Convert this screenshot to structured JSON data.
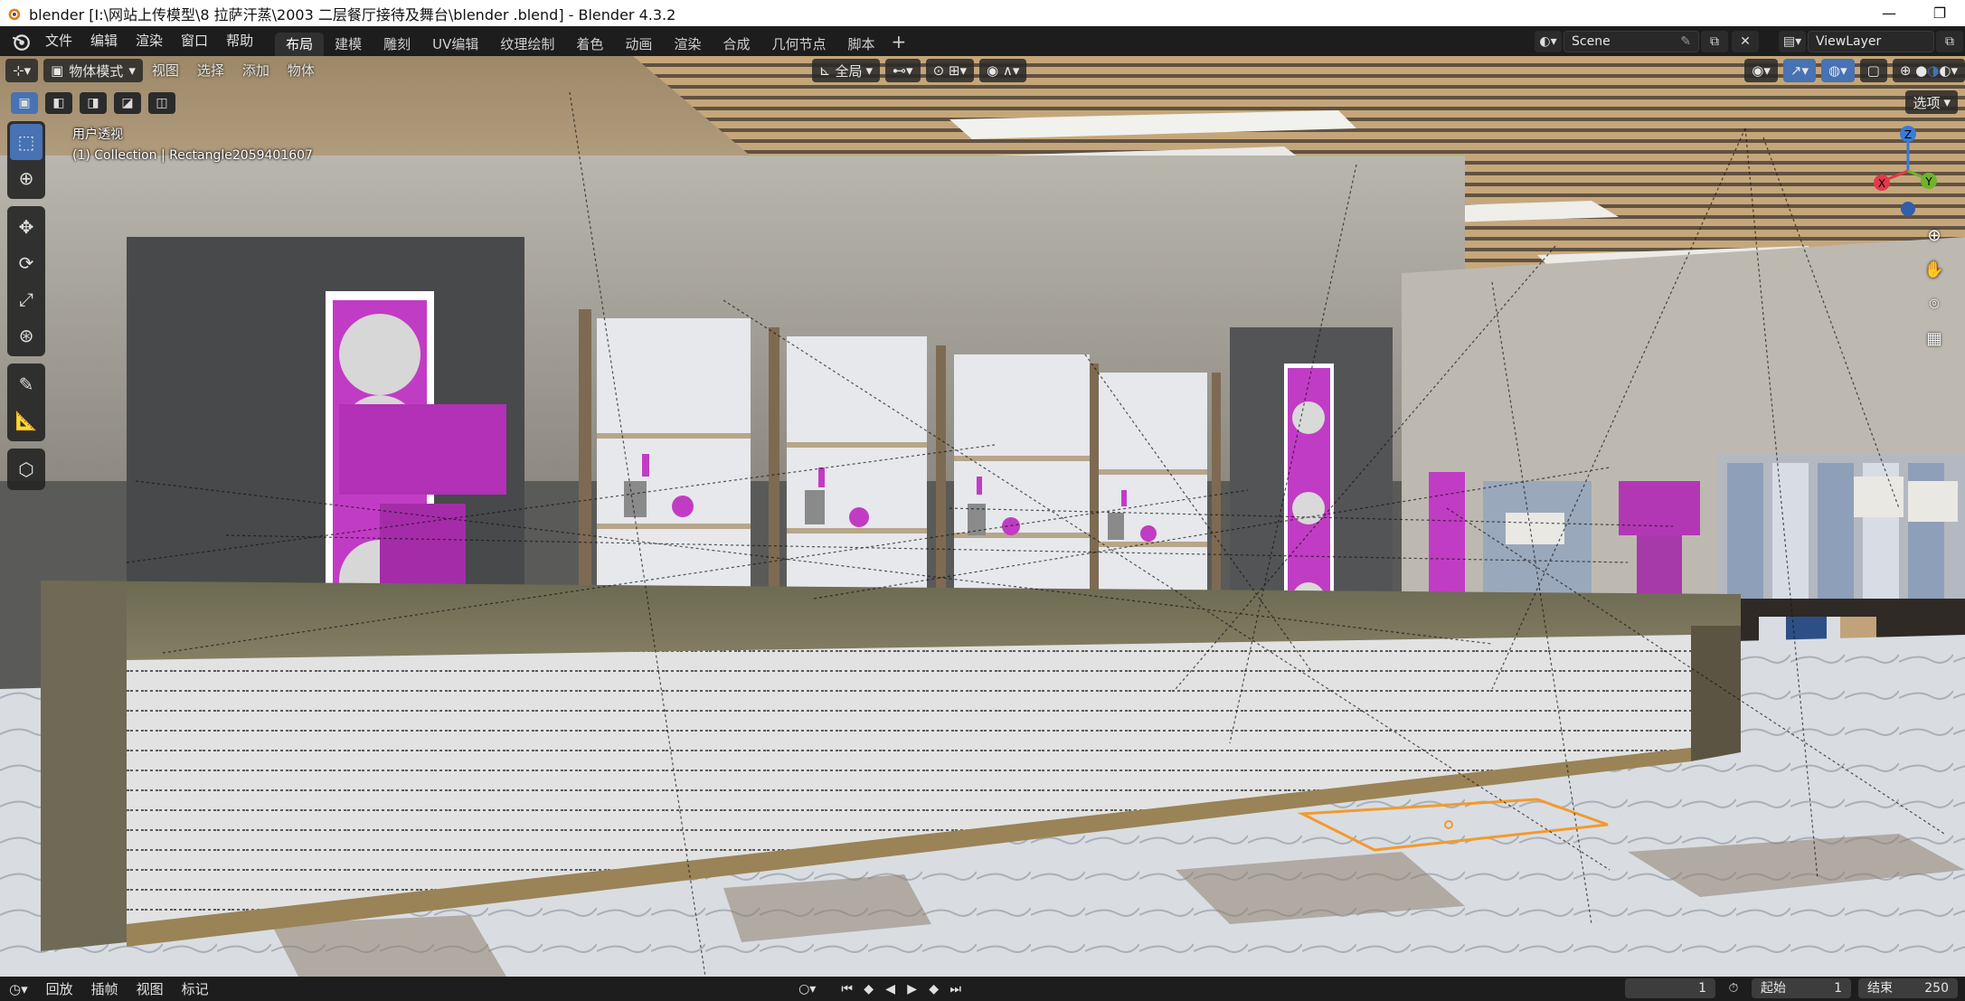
{
  "window": {
    "title": "blender  [I:\\网站上传模型\\8 拉萨汗蒸\\2003 二层餐厅接待及舞台\\blender .blend] - Blender 4.3.2"
  },
  "menu": {
    "items": [
      "文件",
      "编辑",
      "渲染",
      "窗口",
      "帮助"
    ]
  },
  "workspaces": {
    "tabs": [
      "布局",
      "建模",
      "雕刻",
      "UV编辑",
      "纹理绘制",
      "着色",
      "动画",
      "渲染",
      "合成",
      "几何节点",
      "脚本"
    ],
    "active": "布局",
    "add": "+"
  },
  "scene": {
    "name": "Scene"
  },
  "view_layer": {
    "name": "ViewLayer"
  },
  "viewport_header": {
    "mode": "物体模式",
    "menus": [
      "视图",
      "选择",
      "添加",
      "物体"
    ],
    "transform_orientation": "全局",
    "options": "选项"
  },
  "viewport": {
    "view_name": "用户透视",
    "collection_info": "(1) Collection | Rectangle2059401607"
  },
  "gizmo": {
    "x": "X",
    "y": "Y",
    "z": "Z",
    "x_color": "#e03a4a",
    "y_color": "#6db32d",
    "z_color": "#3a7bd8"
  },
  "timeline": {
    "menus": [
      "回放",
      "插帧",
      "视图",
      "标记"
    ],
    "current_frame": "1",
    "start_label": "起始",
    "start_frame": "1",
    "end_label": "结束",
    "end_frame": "250"
  },
  "colors": {
    "accent": "#4772b3",
    "selection": "#f29a2e",
    "magenta": "#c13cc4"
  }
}
